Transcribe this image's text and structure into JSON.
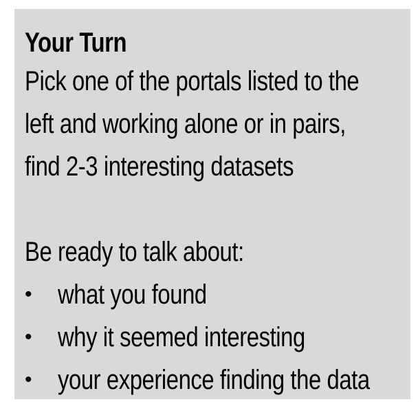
{
  "card": {
    "title": "Your Turn",
    "paragraph_lines": [
      "Pick one of the portals listed to the",
      "left and working alone or in pairs,",
      "find 2-3 interesting datasets"
    ],
    "prompt": "Be ready to talk about:",
    "bullet_symbol": "•",
    "bullets": [
      "what you found",
      "why it seemed interesting",
      "your experience finding the data"
    ]
  }
}
